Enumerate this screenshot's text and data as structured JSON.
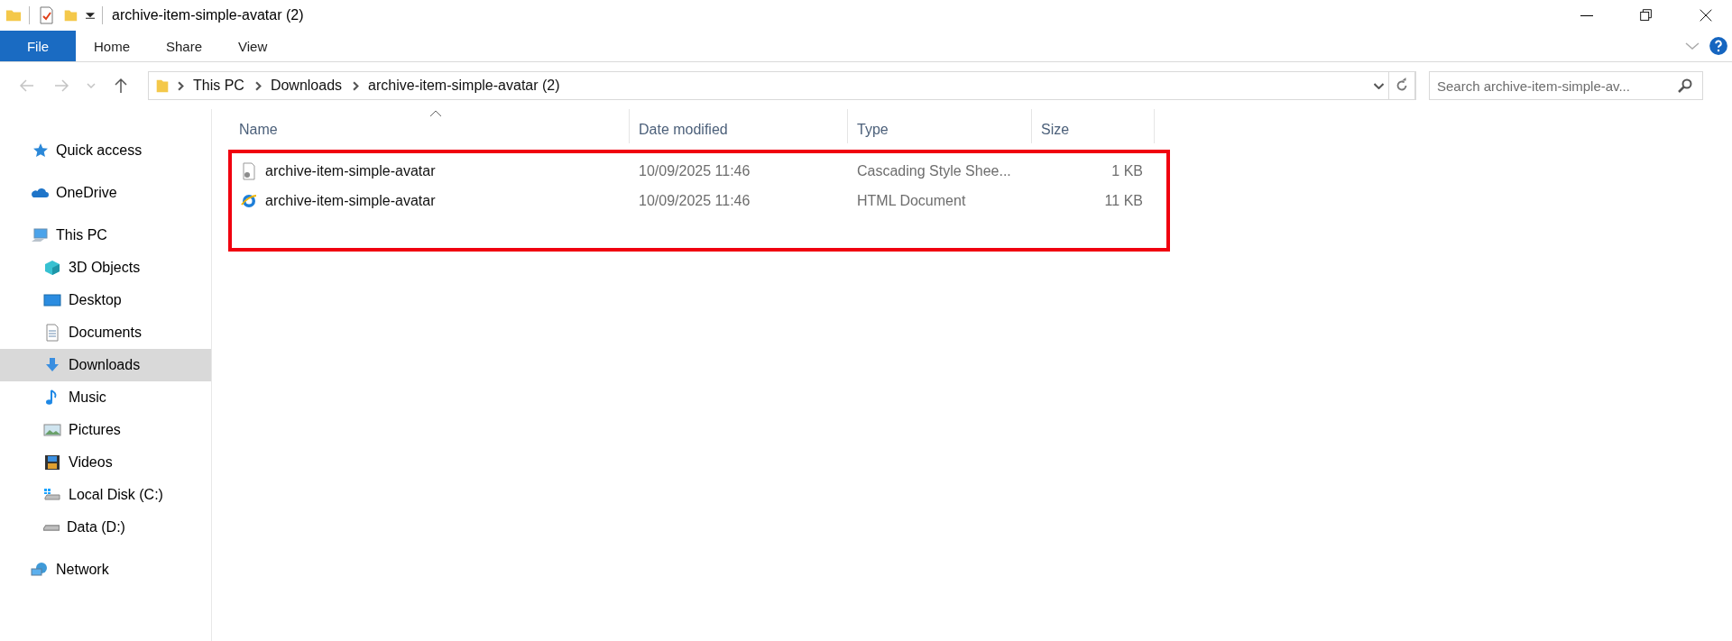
{
  "window": {
    "title": "archive-item-simple-avatar (2)"
  },
  "ribbon": {
    "file_tab": "File",
    "tabs": [
      {
        "label": "Home",
        "selected": false
      },
      {
        "label": "Share",
        "selected": false
      },
      {
        "label": "View",
        "selected": false
      }
    ]
  },
  "navigation": {
    "back": {
      "disabled": true
    },
    "forward": {
      "disabled": true
    },
    "up": {
      "disabled": false
    }
  },
  "address_bar": {
    "path": [
      "This PC",
      "Downloads",
      "archive-item-simple-avatar (2)"
    ]
  },
  "search": {
    "placeholder": "Search archive-item-simple-av..."
  },
  "sidebar": {
    "items": [
      {
        "label": "Quick access",
        "selected": false
      },
      {
        "label": "OneDrive",
        "selected": false
      },
      {
        "label": "This PC",
        "selected": false,
        "children": [
          {
            "label": "3D Objects",
            "selected": false
          },
          {
            "label": "Desktop",
            "selected": false
          },
          {
            "label": "Documents",
            "selected": false
          },
          {
            "label": "Downloads",
            "selected": true
          },
          {
            "label": "Music",
            "selected": false
          },
          {
            "label": "Pictures",
            "selected": false
          },
          {
            "label": "Videos",
            "selected": false
          },
          {
            "label": "Local Disk (C:)",
            "selected": false
          },
          {
            "label": "Data (D:)",
            "selected": false
          }
        ]
      },
      {
        "label": "Network",
        "selected": false
      }
    ]
  },
  "file_list": {
    "columns": [
      {
        "label": "Name",
        "sorted": true
      },
      {
        "label": "Date modified",
        "sorted": false
      },
      {
        "label": "Type",
        "sorted": false
      },
      {
        "label": "Size",
        "sorted": false
      }
    ],
    "rows": [
      {
        "kind": "stylesheet",
        "name": "archive-item-simple-avatar",
        "date_modified": "10/09/2025 11:46",
        "type": "Cascading Style Shee...",
        "size": "1 KB"
      },
      {
        "kind": "html",
        "name": "archive-item-simple-avatar",
        "date_modified": "10/09/2025 11:46",
        "type": "HTML Document",
        "size": "11 KB"
      }
    ]
  }
}
